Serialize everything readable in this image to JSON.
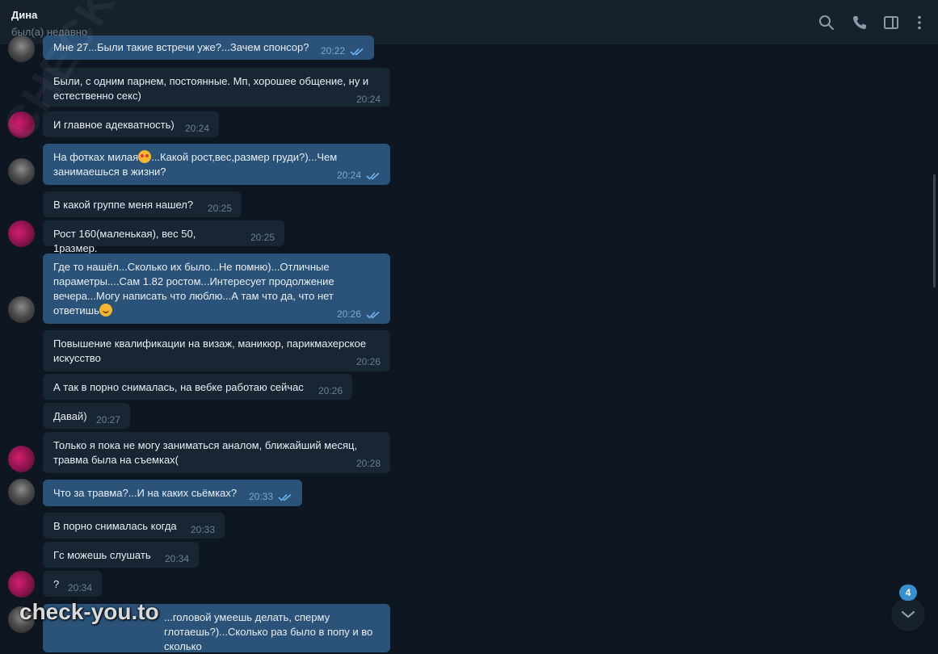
{
  "header": {
    "contact_name": "Дина",
    "status": "был(а) недавно"
  },
  "toolbar": {
    "icons": [
      "search-icon",
      "phone-icon",
      "sidebar-icon",
      "more-icon"
    ]
  },
  "messages": [
    {
      "dir": "out",
      "text": "Мне 27...Были такие встречи уже?...Зачем спонсор?",
      "time": "20:22",
      "read": true
    },
    {
      "dir": "in",
      "text": "Были, с одним парнем, постоянные. Мп, хорошее общение, ну и естественно секс)",
      "time": "20:24"
    },
    {
      "dir": "in",
      "text": "И главное адекватность)",
      "time": "20:24"
    },
    {
      "dir": "out",
      "text_a": "На фотках милая",
      "text_b": "...Какой рост,вес,размер груди?)...Чем занимаешься  в жизни?",
      "time": "20:24",
      "read": true
    },
    {
      "dir": "in",
      "text": "В какой группе меня нашел?",
      "time": "20:25"
    },
    {
      "dir": "in",
      "text": "Рост 160(маленькая), вес 50, 1размер.",
      "time": "20:25"
    },
    {
      "dir": "out",
      "text": "Где то нашёл...Сколько их было...Не помню)...Отличные параметры....Сам 1.82 ростом...Интересует продолжение вечера...Могу написать что люблю...А там что да, что нет ответишь",
      "time": "20:26",
      "read": true
    },
    {
      "dir": "in",
      "text": "Повышение квалификации на визаж, маникюр, парикмахерское искусство",
      "time": "20:26"
    },
    {
      "dir": "in",
      "text": "А так в порно снималась, на вебке работаю сейчас",
      "time": "20:26"
    },
    {
      "dir": "in",
      "text": "Давай)",
      "time": "20:27"
    },
    {
      "dir": "in",
      "text": "Только я пока не могу заниматься аналом, ближайший месяц, травма была на съемках(",
      "time": "20:28"
    },
    {
      "dir": "out",
      "text": "Что за травма?...И на каких сьёмках?",
      "time": "20:33",
      "read": true
    },
    {
      "dir": "in",
      "text": "В порно снималась когда",
      "time": "20:33"
    },
    {
      "dir": "in",
      "text": "Гс можешь слушать",
      "time": "20:34"
    },
    {
      "dir": "in",
      "text": "?",
      "time": "20:34"
    },
    {
      "dir": "out",
      "text": "...головой умеешь делать, сперму глотаешь?)...Сколько раз было в попу и во сколько",
      "time": ""
    }
  ],
  "unread_count": "4",
  "watermark": {
    "diagonal": "CHECK-YOU.ME",
    "footer": "check-you.to"
  },
  "colors": {
    "background": "#0e1621",
    "header": "#17212b",
    "incoming_bubble": "#182533",
    "outgoing_bubble": "#2b5278",
    "read_tick": "#6fb3f0",
    "badge": "#3a8fd0"
  }
}
